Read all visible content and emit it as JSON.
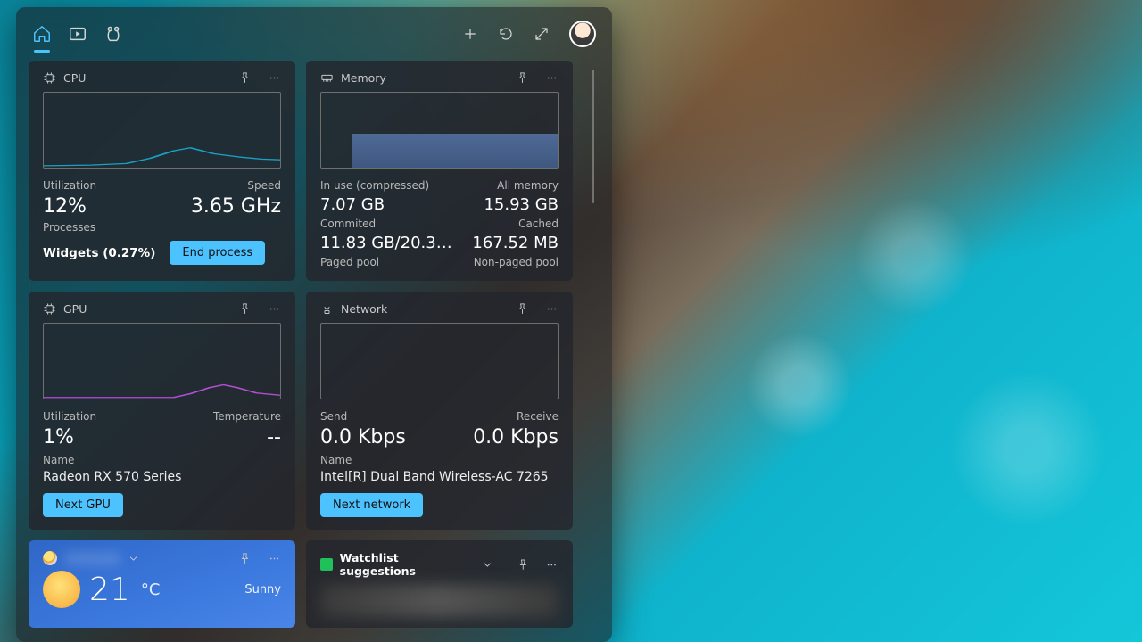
{
  "cards": {
    "cpu": {
      "title": "CPU",
      "util_label": "Utilization",
      "util_value": "12%",
      "speed_label": "Speed",
      "speed_value": "3.65 GHz",
      "proc_label": "Processes",
      "proc_value": "Widgets (0.27%)",
      "end_btn": "End process"
    },
    "mem": {
      "title": "Memory",
      "inuse_label": "In use (compressed)",
      "inuse_value": "7.07 GB",
      "all_label": "All memory",
      "all_value": "15.93 GB",
      "committed_label": "Commited",
      "committed_value": "11.83 GB/20.3…",
      "cached_label": "Cached",
      "cached_value": "167.52 MB",
      "paged_label": "Paged pool",
      "nonpaged_label": "Non-paged pool"
    },
    "gpu": {
      "title": "GPU",
      "util_label": "Utilization",
      "util_value": "1%",
      "temp_label": "Temperature",
      "temp_value": "--",
      "name_label": "Name",
      "name_value": "Radeon RX 570 Series",
      "next_btn": "Next GPU"
    },
    "net": {
      "title": "Network",
      "send_label": "Send",
      "send_value": "0.0 Kbps",
      "recv_label": "Receive",
      "recv_value": "0.0 Kbps",
      "name_label": "Name",
      "name_value": "Intel[R] Dual Band Wireless-AC 7265",
      "next_btn": "Next network"
    },
    "weather": {
      "temp": "21",
      "unit": "°C",
      "condition": "Sunny"
    },
    "watchlist": {
      "title": "Watchlist suggestions"
    }
  },
  "chart_data": [
    {
      "type": "line",
      "title": "CPU utilization",
      "ylim": [
        0,
        100
      ],
      "values": [
        4,
        5,
        6,
        5,
        8,
        12,
        22,
        24,
        20,
        18,
        16,
        15,
        14
      ]
    },
    {
      "type": "area",
      "title": "Memory in use",
      "ylim": [
        0,
        15.93
      ],
      "values": [
        7.0,
        7.0,
        7.05,
        7.07,
        7.07,
        7.07,
        7.07
      ]
    },
    {
      "type": "line",
      "title": "GPU utilization",
      "ylim": [
        0,
        100
      ],
      "values": [
        0,
        0,
        0,
        0,
        1,
        3,
        6,
        8,
        9,
        8,
        6,
        4,
        1
      ]
    },
    {
      "type": "line",
      "title": "Network throughput",
      "ylim": [
        0,
        1
      ],
      "values": [
        0,
        0,
        0,
        0,
        0,
        0,
        0,
        0
      ]
    }
  ]
}
